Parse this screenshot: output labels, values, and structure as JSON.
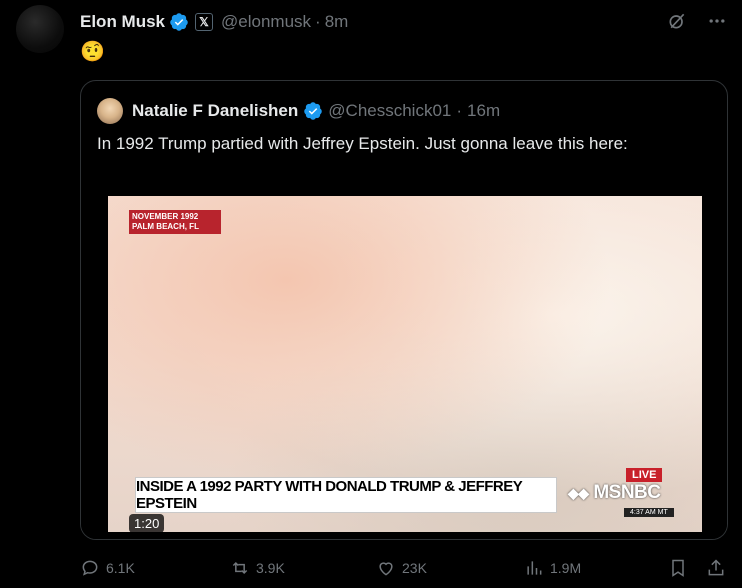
{
  "post": {
    "author_name": "Elon Musk",
    "x_badge": "𝕏",
    "handle": "@elonmusk",
    "separator": "·",
    "time": "8m",
    "content": "🤨"
  },
  "quote": {
    "author_name": "Natalie F Danelishen",
    "handle": "@Chesschick01",
    "separator": "·",
    "time": "16m",
    "text": "In 1992 Trump partied with Jeffrey Epstein. Just gonna leave this here:",
    "video": {
      "location_line1": "NOVEMBER 1992",
      "location_line2": "PALM BEACH, FL",
      "headline": "INSIDE A 1992 PARTY WITH DONALD TRUMP & JEFFREY EPSTEIN",
      "live_badge": "LIVE",
      "network": "MSNBC",
      "clock": "4:37 AM MT",
      "duration": "1:20"
    }
  },
  "actions": {
    "replies": "6.1K",
    "reposts": "3.9K",
    "likes": "23K",
    "views": "1.9M"
  },
  "icons": {
    "verified": "verified-badge-icon",
    "grok": "grok-icon",
    "more": "more-icon",
    "reply": "reply-icon",
    "repost": "repost-icon",
    "like": "heart-icon",
    "views": "views-icon",
    "bookmark": "bookmark-icon",
    "share": "share-icon"
  },
  "colors": {
    "background": "#000000",
    "text": "#e7e9ea",
    "muted": "#71767b",
    "verified": "#1d9bf0",
    "border": "#2f3336"
  }
}
